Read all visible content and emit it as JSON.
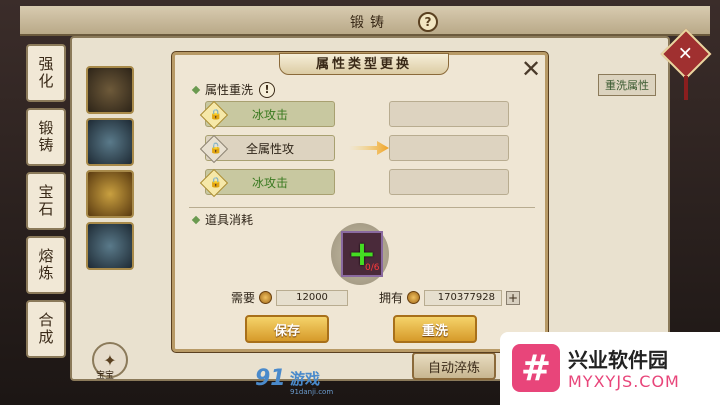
{
  "background": {
    "window_title": "锻铸",
    "help_glyph": "?",
    "close_glyph": "✕",
    "tabs": [
      "强化",
      "锻铸",
      "宝石",
      "熔炼",
      "合成"
    ],
    "active_tab": "锻铸",
    "right_button": "重洗属性",
    "auto_button": "自动淬炼",
    "bottom_icon_label": "宝宝"
  },
  "dialog": {
    "title": "属性类型更换",
    "close_glyph": "✕",
    "section_reroll": "属性重洗",
    "warn_glyph": "!",
    "attributes": [
      {
        "label": "冰攻击",
        "style": "green",
        "locked": true
      },
      {
        "label": "全属性攻",
        "style": "plain",
        "locked": false
      },
      {
        "label": "冰攻击",
        "style": "green",
        "locked": true
      }
    ],
    "section_items": "道具消耗",
    "item_count": "0/6",
    "required_label": "需要",
    "required_value": "12000",
    "owned_label": "拥有",
    "owned_value": "170377928",
    "plus_glyph": "+",
    "save_button": "保存",
    "reroll_button": "重洗"
  },
  "watermarks": {
    "left_brand": "91",
    "left_brand_text": "游戏",
    "left_url": "91danji.com",
    "right_logo": "#",
    "right_title": "兴业软件园",
    "right_url": "MYXYJS.COM"
  },
  "colors": {
    "accent_gold": "#d69a2a",
    "green_text": "#3a7a20",
    "brand_pink": "#e8457a"
  }
}
